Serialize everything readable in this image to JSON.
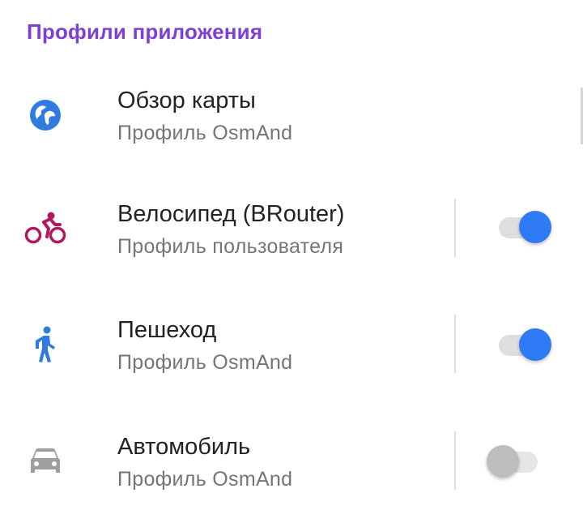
{
  "section": {
    "title": "Профили приложения"
  },
  "profiles": [
    {
      "name": "Обзор карты",
      "type": "Профиль OsmAnd",
      "icon": "globe-icon",
      "icon_color": "#2f7bdf",
      "has_toggle": false
    },
    {
      "name": "Велосипед (BRouter)",
      "type": "Профиль пользователя",
      "icon": "bicycle-icon",
      "icon_color": "#b0195e",
      "has_toggle": true,
      "enabled": true
    },
    {
      "name": "Пешеход",
      "type": "Профиль OsmAnd",
      "icon": "pedestrian-icon",
      "icon_color": "#2f7bdf",
      "has_toggle": true,
      "enabled": true
    },
    {
      "name": "Автомобиль",
      "type": "Профиль OsmAnd",
      "icon": "car-icon",
      "icon_color": "#9e9e9e",
      "has_toggle": true,
      "enabled": false
    }
  ],
  "colors": {
    "accent": "#7e3fd4",
    "switch_on": "#2f7bf5",
    "switch_off": "#bdbdbd"
  }
}
